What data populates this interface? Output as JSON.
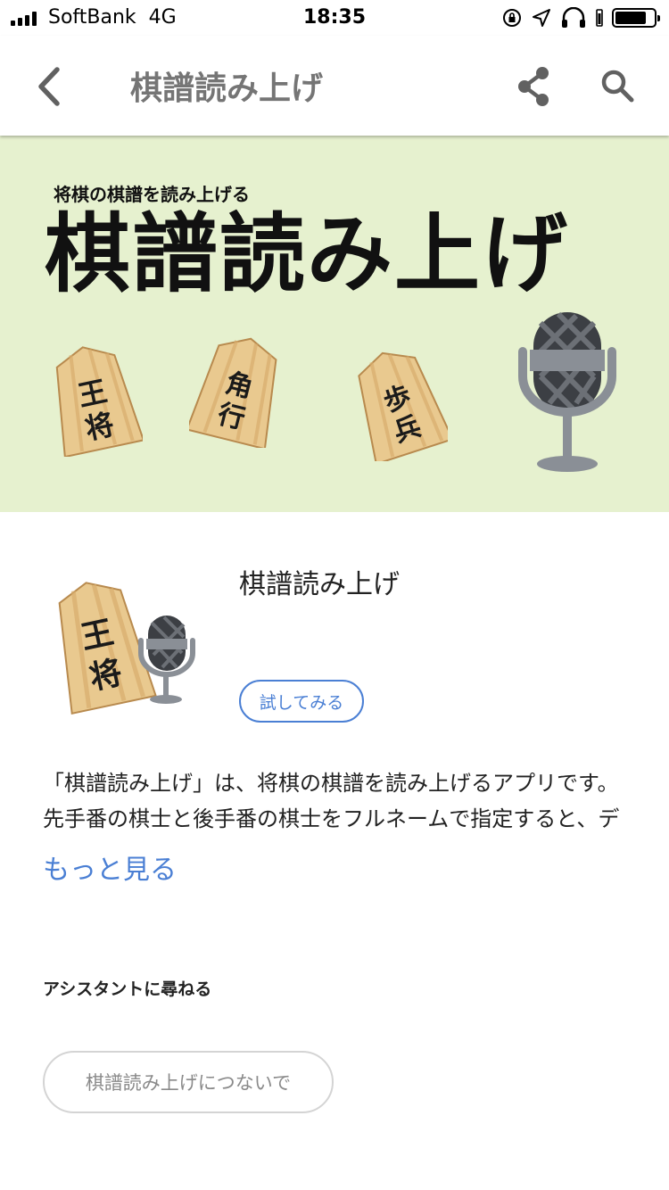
{
  "status_bar": {
    "carrier": "SoftBank",
    "network": "4G",
    "time": "18:35",
    "battery_level": 0.8
  },
  "app_bar": {
    "title": "棋譜読み上げ",
    "icons": [
      "back-icon",
      "share-icon",
      "search-icon"
    ]
  },
  "banner": {
    "subtitle": "将棋の棋譜を読み上げる",
    "title": "棋譜読み上げ",
    "background_color": "#e6f1cf",
    "pieces": [
      {
        "top": "王",
        "bottom": "将"
      },
      {
        "top": "角",
        "bottom": "行"
      },
      {
        "top": "歩",
        "bottom": "兵"
      }
    ]
  },
  "app_info": {
    "name": "棋譜読み上げ",
    "try_button": "試してみる",
    "icon_piece": {
      "top": "王",
      "bottom": "将"
    }
  },
  "description": {
    "line1": "「棋譜読み上げ」は、将棋の棋譜を読み上げるアプリです。",
    "line2": "先手番の棋士と後手番の棋士をフルネームで指定すると、デ",
    "more": "もっと見る"
  },
  "ask_section": {
    "heading": "アシスタントに尋ねる",
    "suggestion": "棋譜読み上げにつないで"
  },
  "colors": {
    "accent": "#4a7fd4",
    "title_gray": "#757575",
    "piece_wood": "#e9c98f",
    "mic_gray": "#8a8f96"
  }
}
